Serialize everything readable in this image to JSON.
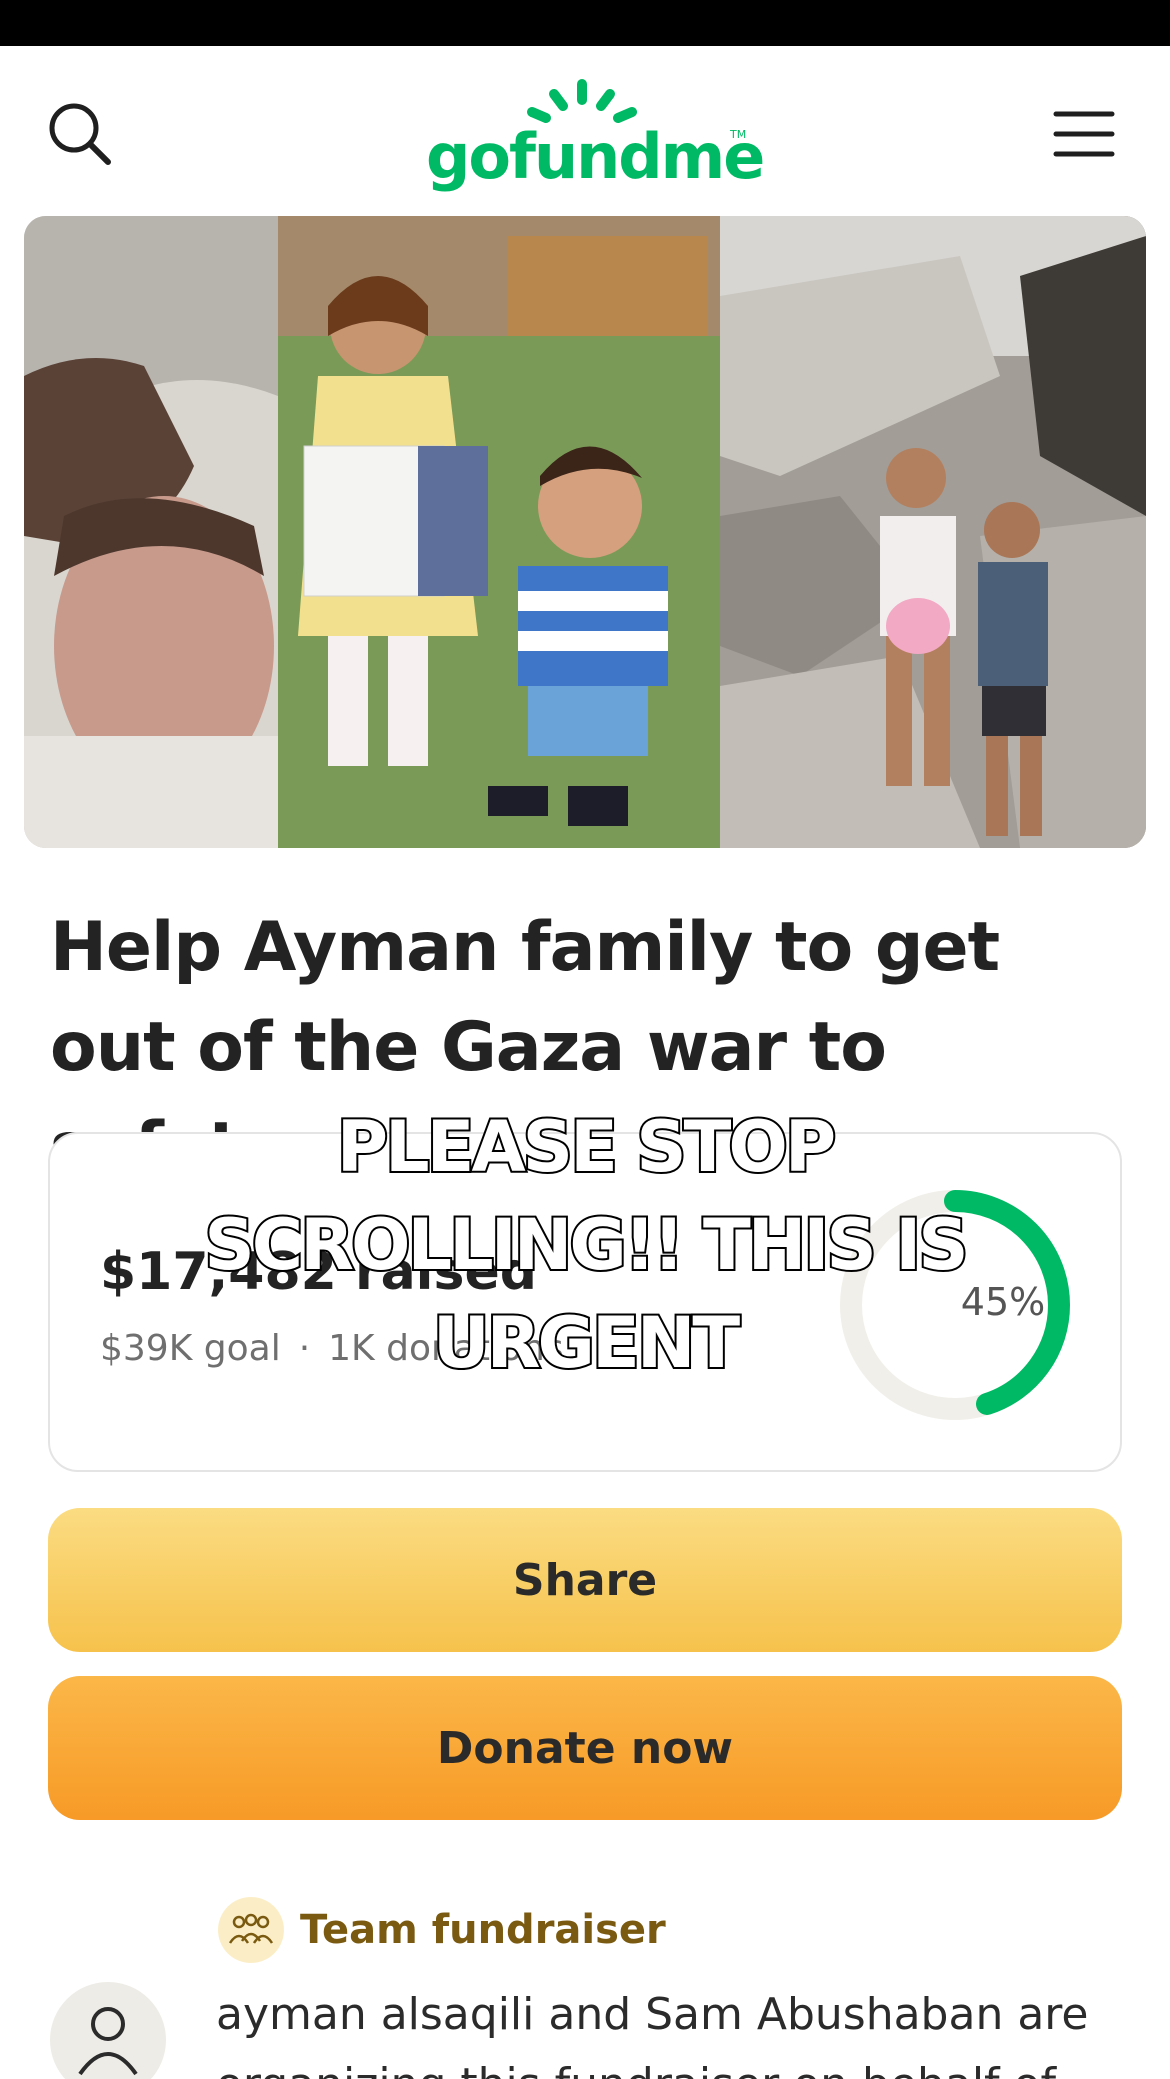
{
  "header": {
    "logo_text": "gofundme",
    "logo_tm": "TM",
    "search_icon": "search-icon",
    "menu_icon": "hamburger-menu-icon"
  },
  "hero": {
    "panels": [
      "newborn baby photo",
      "two children with certificate",
      "children sitting on rubble"
    ]
  },
  "campaign": {
    "title": "Help Ayman family to get out of the Gaza war to safety"
  },
  "stats": {
    "raised": "$17,482 raised",
    "goal": "$39K goal",
    "separator": "·",
    "donations": "1K donations",
    "progress_label": "45%",
    "progress": 0.45
  },
  "overlay": {
    "text": "PLEASE STOP SCROLLING!! THIS IS URGENT"
  },
  "buttons": {
    "share": "Share",
    "donate": "Donate now"
  },
  "team": {
    "label": "Team fundraiser",
    "icon": "people-group-icon"
  },
  "organizer": {
    "text": "ayman alsaqili and Sam Abushaban are organizing this fundraiser on behalf of"
  },
  "colors": {
    "brand_green": "#00b964",
    "share_yellow": "#f6c24c",
    "donate_orange": "#f79a27",
    "team_badge": "#fbeec7"
  }
}
